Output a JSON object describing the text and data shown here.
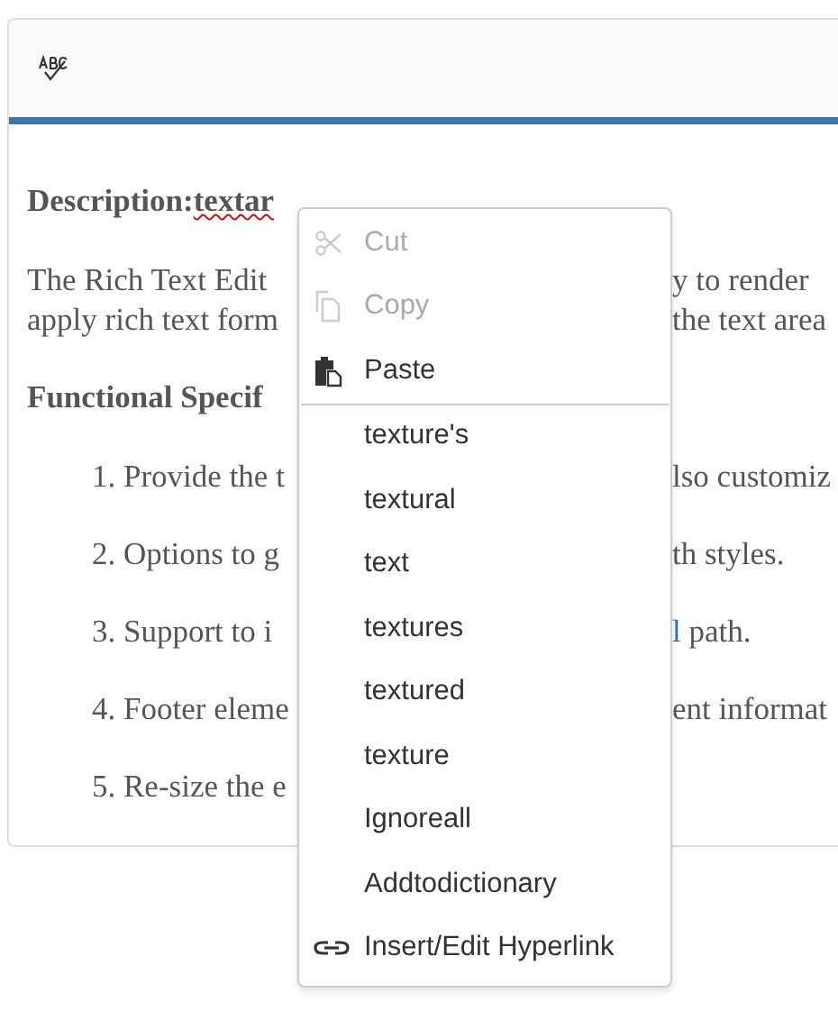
{
  "toolbar": {
    "tools": [
      {
        "kind": "spellcheck"
      }
    ]
  },
  "content": {
    "heading": {
      "label": "Description:",
      "misspelled": "textar"
    },
    "paragraph_lines": [
      {
        "left": "The Rich Text Edit",
        "right": "y to render"
      },
      {
        "left": "apply rich text form",
        "right": "the text area"
      }
    ],
    "subheading": "Functional Specif",
    "list_items": [
      {
        "left": "1. Provide the t",
        "right": "lso customiz"
      },
      {
        "left": "2. Options to g",
        "right": "th styles."
      },
      {
        "left": "3. Support to i",
        "link": "l",
        "right": " path."
      },
      {
        "left": "4. Footer eleme",
        "right": "ent informat"
      },
      {
        "left": "5. Re-size the e"
      }
    ]
  },
  "context_menu": {
    "items": [
      {
        "kind": "cut",
        "label": "Cut",
        "disabled": true
      },
      {
        "kind": "copy",
        "label": "Copy",
        "disabled": true
      },
      {
        "kind": "paste",
        "label": "Paste",
        "disabled": false
      },
      {
        "kind": "separator"
      },
      {
        "kind": "suggestion",
        "label": "texture's",
        "disabled": false
      },
      {
        "kind": "suggestion",
        "label": "textural",
        "disabled": false
      },
      {
        "kind": "suggestion",
        "label": "text",
        "disabled": false
      },
      {
        "kind": "suggestion",
        "label": "textures",
        "disabled": false
      },
      {
        "kind": "suggestion",
        "label": "textured",
        "disabled": false
      },
      {
        "kind": "suggestion",
        "label": "texture",
        "disabled": false
      },
      {
        "kind": "suggestion",
        "label": "Ignoreall",
        "disabled": false
      },
      {
        "kind": "suggestion",
        "label": "Addtodictionary",
        "disabled": false
      },
      {
        "kind": "link",
        "label": "Insert/Edit Hyperlink",
        "disabled": false
      }
    ]
  }
}
